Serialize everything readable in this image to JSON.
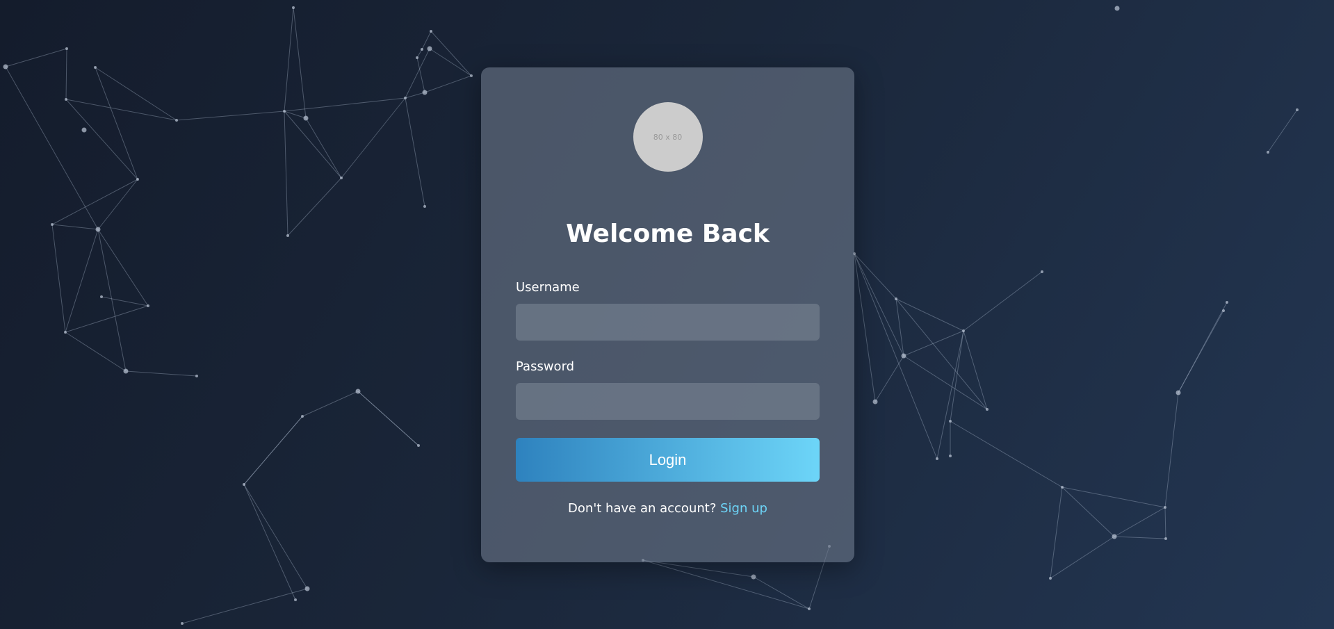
{
  "login": {
    "avatar_placeholder": "80 x 80",
    "title": "Welcome Back",
    "username_label": "Username",
    "username_value": "",
    "password_label": "Password",
    "password_value": "",
    "login_button": "Login",
    "signup_prompt": "Don't have an account?",
    "signup_link": "Sign up"
  },
  "colors": {
    "background_start": "#141c2c",
    "background_end": "#233652",
    "button_start": "#2e82be",
    "button_end": "#6dd5f8",
    "link": "#6dd5f8"
  }
}
